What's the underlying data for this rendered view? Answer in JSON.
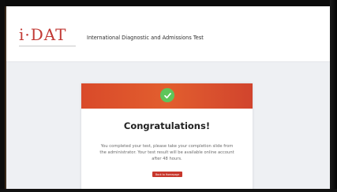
{
  "header": {
    "logo_text": "i·DAT",
    "title": "International Diagnostic and Admissions Test"
  },
  "card": {
    "banner_icon": "check-icon",
    "title": "Congratulations!",
    "message": "You completed your test, please take your completion slide from the administrator. Your test result will be available online account after 48 hours.",
    "button_label": "Back to Homepage"
  },
  "colors": {
    "brand_red": "#c23a35",
    "banner": "#d94a2a",
    "success_green": "#5ec55a",
    "button": "#c8372c"
  }
}
